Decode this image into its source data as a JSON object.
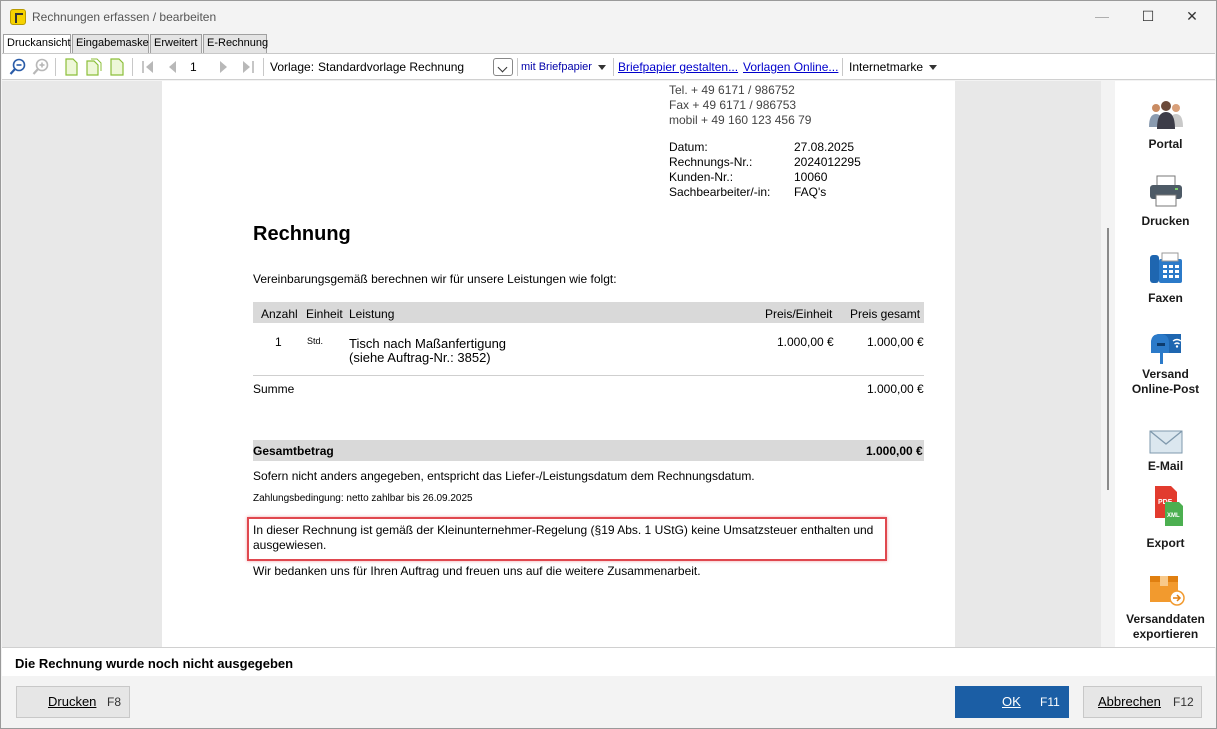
{
  "window": {
    "title": "Rechnungen erfassen / bearbeiten"
  },
  "tabs": [
    {
      "label": "Druckansicht"
    },
    {
      "label": "Eingabemaske"
    },
    {
      "label": "Erweitert"
    },
    {
      "label": "E-Rechnung"
    }
  ],
  "toolbar": {
    "page_number": "1",
    "template_label": "Vorlage:",
    "template_value": "Standardvorlage Rechnung",
    "letterhead_option": "mit Briefpapier",
    "letterhead_link": "Briefpapier gestalten...",
    "templates_online_link": "Vorlagen Online...",
    "postage_label": "Internetmarke"
  },
  "document": {
    "contact": {
      "tel": "Tel. + 49 6171 / 986752",
      "fax": "Fax + 49 6171 / 986753",
      "mobil": "mobil + 49 160 123 456 79"
    },
    "meta": [
      {
        "label": "Datum:",
        "value": "27.08.2025"
      },
      {
        "label": "Rechnungs-Nr.:",
        "value": "2024012295"
      },
      {
        "label": "Kunden-Nr.:",
        "value": "10060"
      },
      {
        "label": "Sachbearbeiter/-in:",
        "value": "FAQ's"
      }
    ],
    "heading": "Rechnung",
    "intro": "Vereinbarungsgemäß berechnen wir für unsere Leistungen wie folgt:",
    "table": {
      "headers": {
        "anzahl": "Anzahl",
        "einheit": "Einheit",
        "leistung": "Leistung",
        "preis_einheit": "Preis/Einheit",
        "preis_gesamt": "Preis gesamt"
      },
      "rows": [
        {
          "anzahl": "1",
          "einheit": "Std.",
          "leistung_1": "Tisch nach Maßanfertigung",
          "leistung_2": "(siehe Auftrag-Nr.: 3852)",
          "preis_einheit": "1.000,00 €",
          "preis_gesamt": "1.000,00 €"
        }
      ],
      "summe_label": "Summe",
      "summe_value": "1.000,00 €",
      "gesamt_label": "Gesamtbetrag",
      "gesamt_value": "1.000,00 €"
    },
    "delivery_note": "Sofern nicht anders angegeben, entspricht das Liefer-/Leistungsdatum dem Rechnungsdatum.",
    "payment_terms": "Zahlungsbedingung: netto zahlbar bis 26.09.2025",
    "tax_note_1": "In dieser Rechnung ist gemäß der Kleinunternehmer-Regelung (§19 Abs. 1 UStG) keine Umsatzsteuer enthalten und",
    "tax_note_2": "ausgewiesen.",
    "closing": "Wir bedanken uns für Ihren Auftrag und freuen uns auf die weitere Zusammenarbeit."
  },
  "side_actions": [
    {
      "label": "Portal",
      "icon": "people-icon"
    },
    {
      "label": "Drucken",
      "icon": "printer-icon"
    },
    {
      "label": "Faxen",
      "icon": "fax-icon"
    },
    {
      "label_1": "Versand",
      "label_2": "Online-Post",
      "icon": "mailbox-icon"
    },
    {
      "label": "E-Mail",
      "icon": "envelope-icon"
    },
    {
      "label": "Export",
      "icon": "pdf-export-icon"
    },
    {
      "label_1": "Versanddaten",
      "label_2": "exportieren",
      "icon": "package-export-icon"
    }
  ],
  "status": {
    "message": "Die Rechnung wurde noch nicht ausgegeben"
  },
  "footer": {
    "print_button": "Drucken",
    "print_key": "F8",
    "ok_button": "OK",
    "ok_key": "F11",
    "cancel_button": "Abbrechen",
    "cancel_key": "F12"
  },
  "colors": {
    "primary_button": "#1b5ea5",
    "highlight_border": "#e0484f",
    "table_header_bg": "#d9d9d9"
  }
}
